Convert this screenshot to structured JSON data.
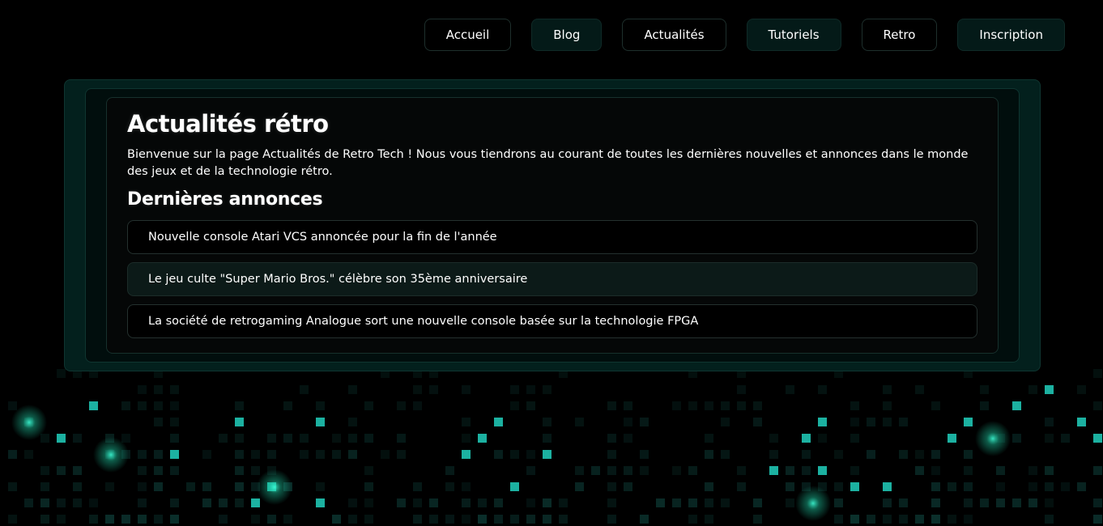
{
  "nav": {
    "items": [
      {
        "label": "Accueil",
        "tinted": false
      },
      {
        "label": "Blog",
        "tinted": true
      },
      {
        "label": "Actualités",
        "tinted": false
      },
      {
        "label": "Tutoriels",
        "tinted": true
      },
      {
        "label": "Retro",
        "tinted": false
      },
      {
        "label": "Inscription",
        "tinted": true
      }
    ]
  },
  "main": {
    "title": "Actualités rétro",
    "intro": "Bienvenue sur la page Actualités de Retro Tech ! Nous vous tiendrons au courant de toutes les dernières nouvelles et annonces dans le monde des jeux et de la technologie rétro.",
    "section_title": "Dernières annonces",
    "announcements": [
      {
        "text": "Nouvelle console Atari VCS annoncée pour la fin de l'année",
        "tinted": false
      },
      {
        "text": "Le jeu culte \"Super Mario Bros.\" célèbre son 35ème anniversaire",
        "tinted": true
      },
      {
        "text": "La société de retrogaming Analogue sort une nouvelle console basée sur la technologie FPGA",
        "tinted": false
      }
    ]
  },
  "colors": {
    "background": "#000000",
    "accent": "#1ec8b0",
    "panel_outer": "#03201d",
    "panel_border": "#0f3530"
  }
}
